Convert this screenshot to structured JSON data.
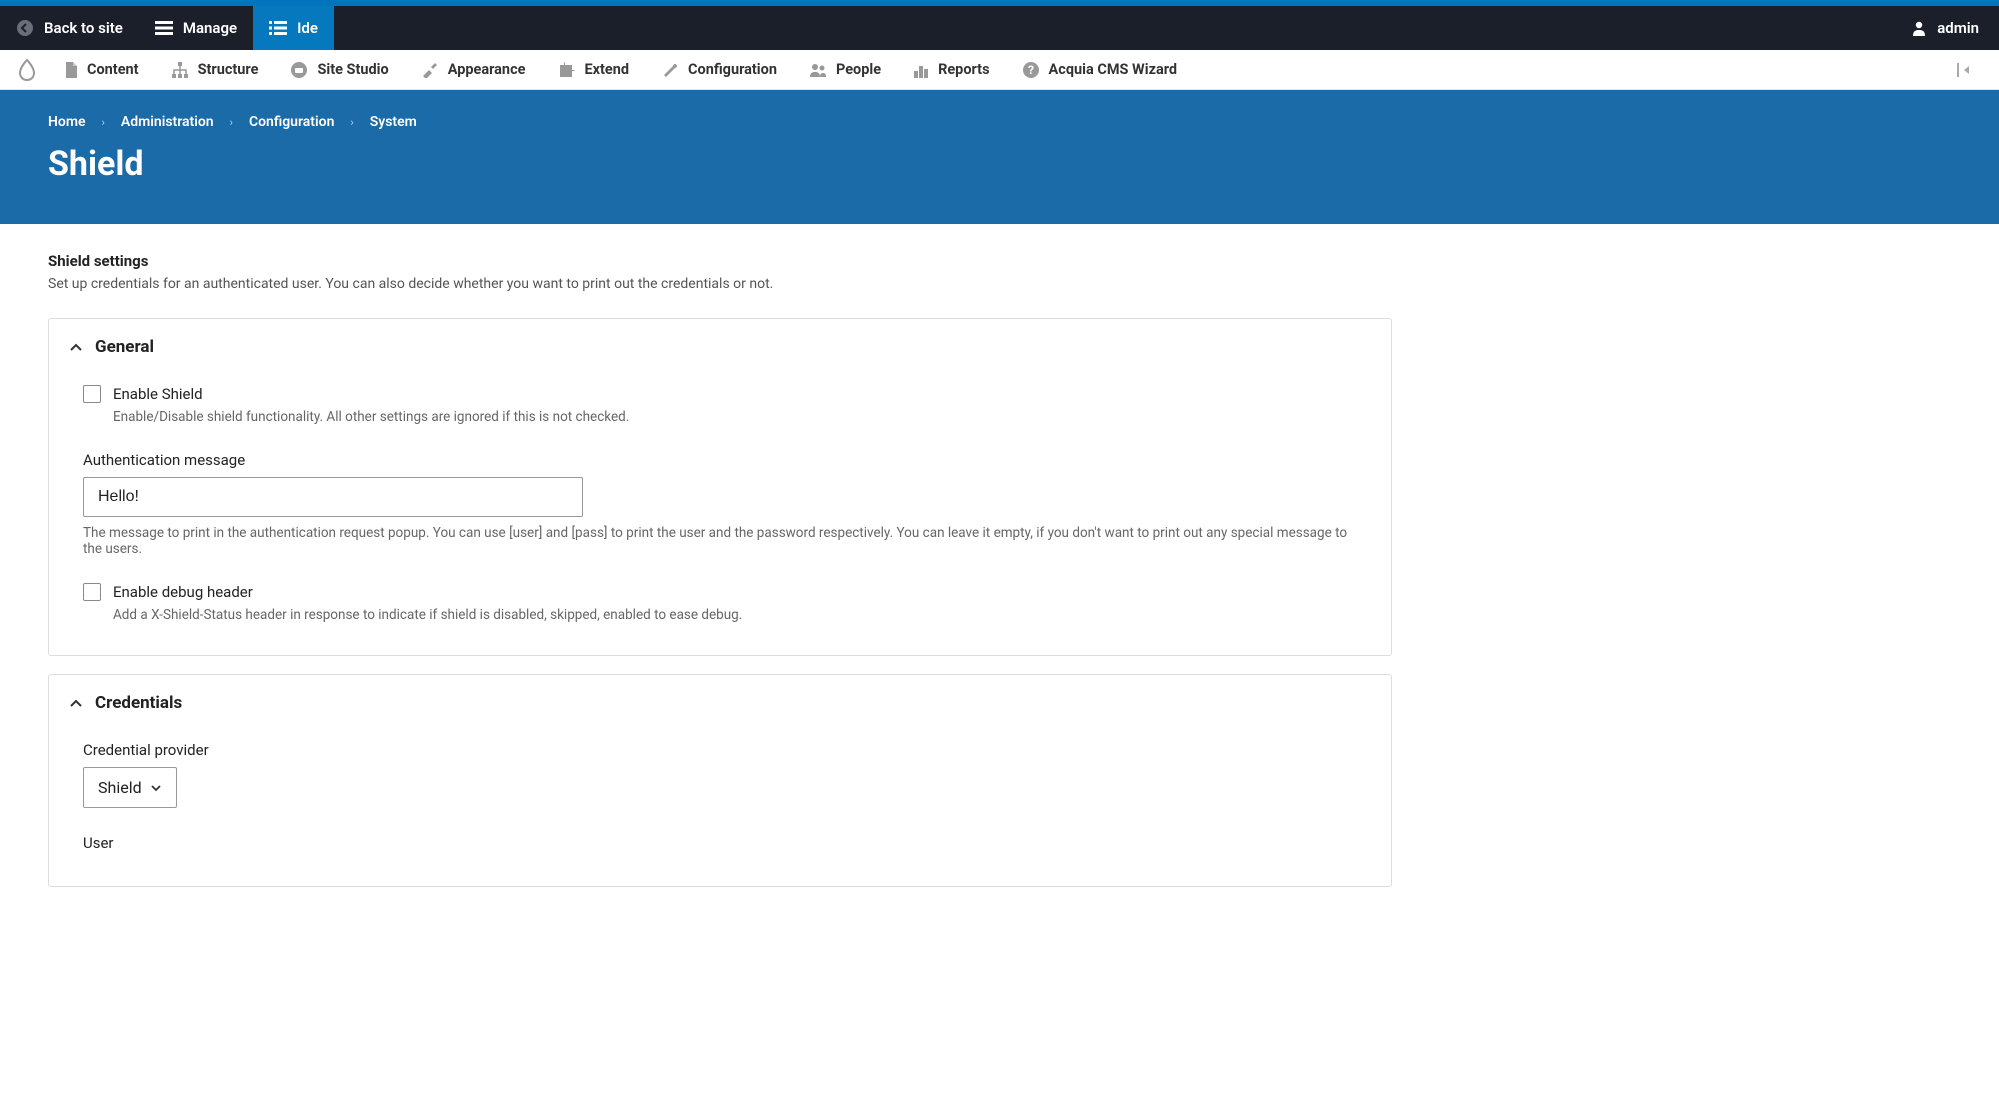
{
  "toolbar": {
    "back_to_site": "Back to site",
    "manage": "Manage",
    "ide": "Ide",
    "user": "admin"
  },
  "admin_nav": {
    "items": [
      {
        "label": "Content"
      },
      {
        "label": "Structure"
      },
      {
        "label": "Site Studio"
      },
      {
        "label": "Appearance"
      },
      {
        "label": "Extend"
      },
      {
        "label": "Configuration"
      },
      {
        "label": "People"
      },
      {
        "label": "Reports"
      },
      {
        "label": "Acquia CMS Wizard"
      }
    ]
  },
  "breadcrumb": {
    "items": [
      "Home",
      "Administration",
      "Configuration",
      "System"
    ]
  },
  "page": {
    "title": "Shield",
    "section_title": "Shield settings",
    "section_desc": "Set up credentials for an authenticated user. You can also decide whether you want to print out the credentials or not."
  },
  "general": {
    "legend": "General",
    "enable_shield_label": "Enable Shield",
    "enable_shield_help": "Enable/Disable shield functionality. All other settings are ignored if this is not checked.",
    "auth_msg_label": "Authentication message",
    "auth_msg_value": "Hello!",
    "auth_msg_help": "The message to print in the authentication request popup. You can use [user] and [pass] to print the user and the password respectively. You can leave it empty, if you don't want to print out any special message to the users.",
    "debug_label": "Enable debug header",
    "debug_help": "Add a X-Shield-Status header in response to indicate if shield is disabled, skipped, enabled to ease debug."
  },
  "credentials": {
    "legend": "Credentials",
    "provider_label": "Credential provider",
    "provider_value": "Shield",
    "user_label": "User"
  }
}
